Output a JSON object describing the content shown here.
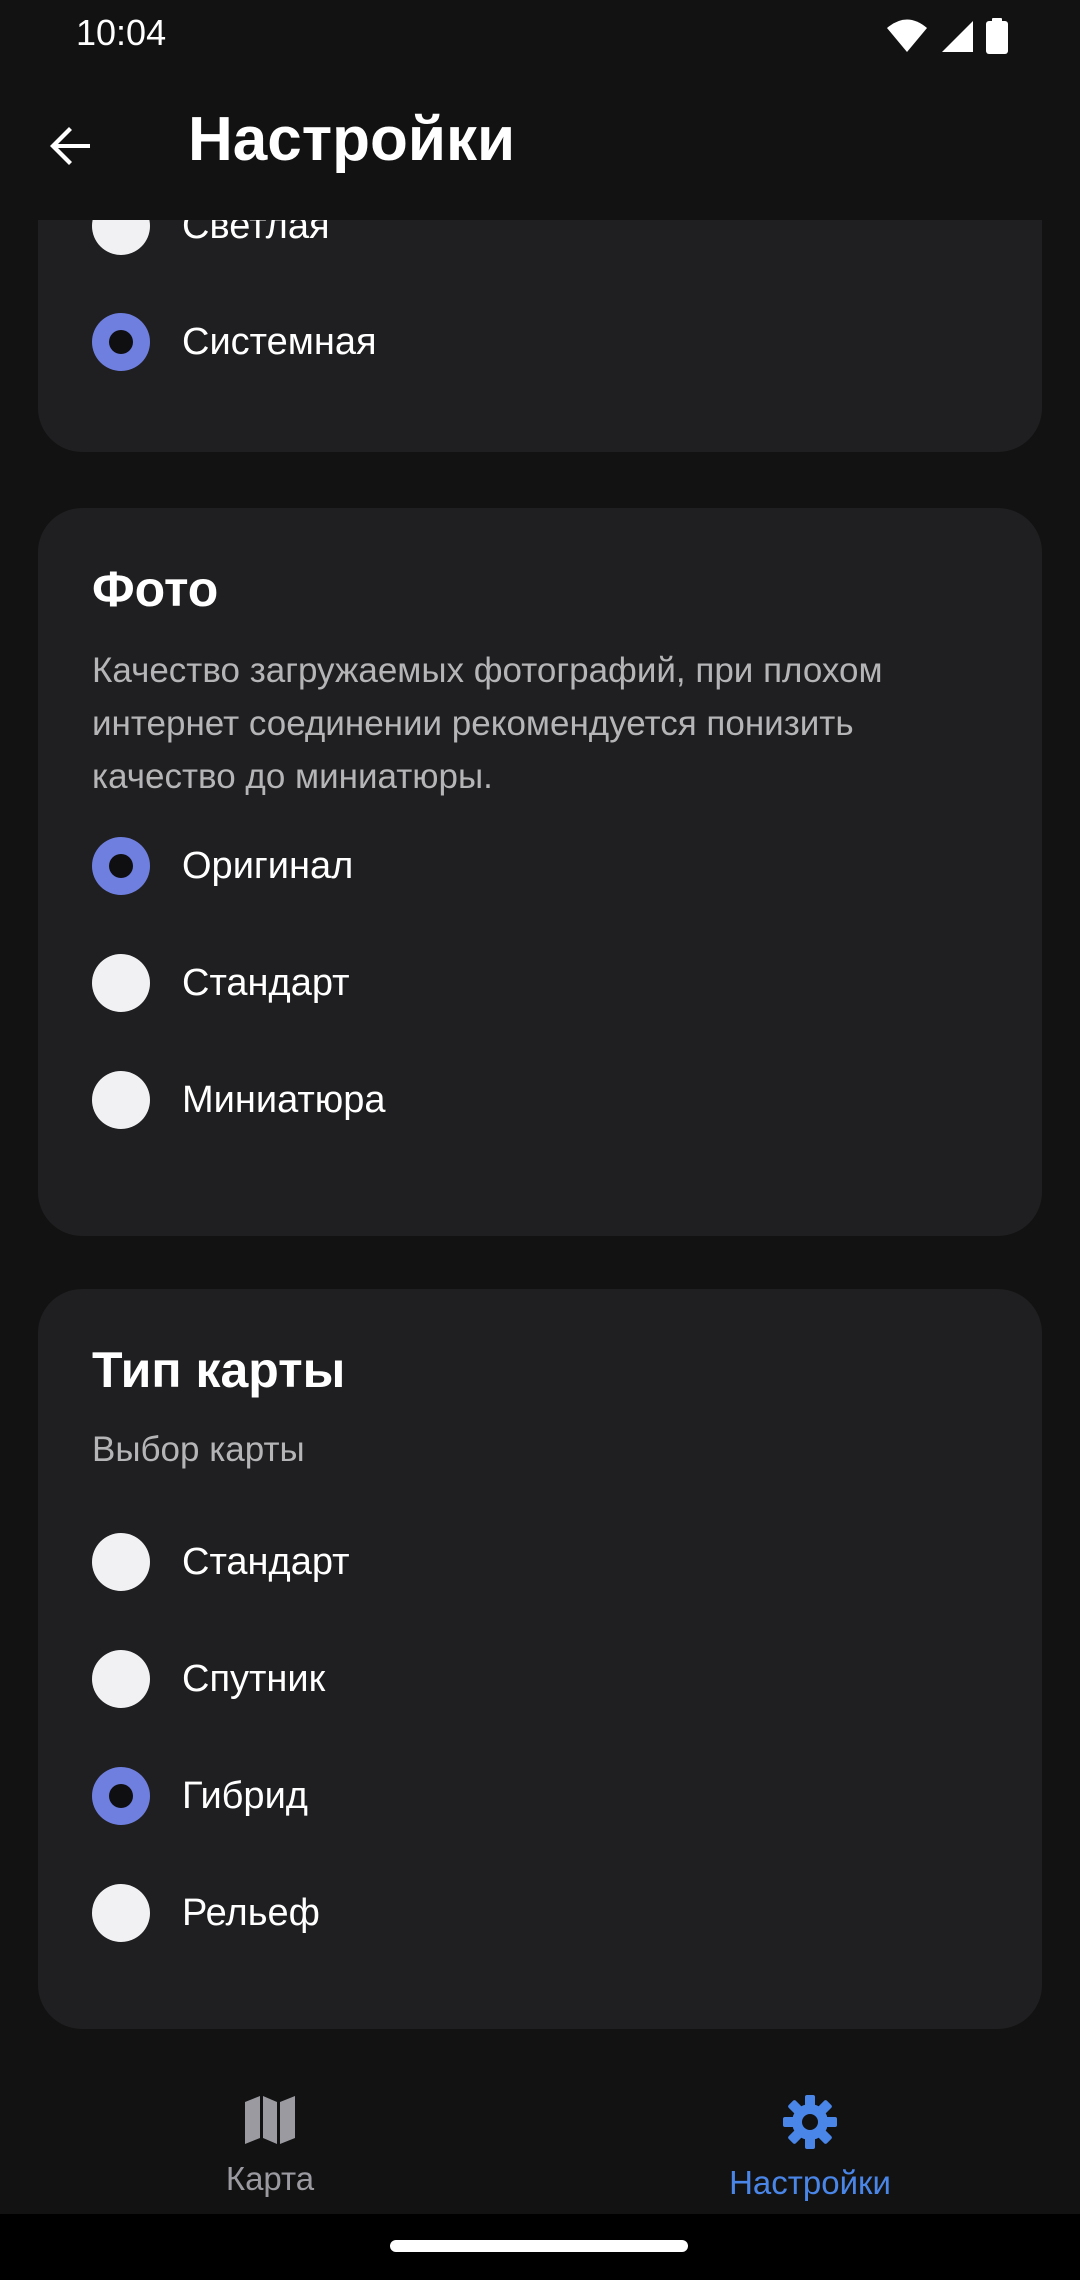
{
  "status_bar": {
    "time": "10:04"
  },
  "app_bar": {
    "title": "Настройки"
  },
  "theme_card": {
    "options": [
      {
        "label": "Светлая",
        "selected": false
      },
      {
        "label": "Системная",
        "selected": true
      }
    ]
  },
  "photo_card": {
    "title": "Фото",
    "description": "Качество загружаемых фотографий, при плохом интернет соединении рекомендуется понизить качество до миниатюры.",
    "options": [
      {
        "label": "Оригинал",
        "selected": true
      },
      {
        "label": "Стандарт",
        "selected": false
      },
      {
        "label": "Миниатюра",
        "selected": false
      }
    ]
  },
  "map_card": {
    "title": "Тип карты",
    "description": "Выбор карты",
    "options": [
      {
        "label": "Стандарт",
        "selected": false
      },
      {
        "label": "Спутник",
        "selected": false
      },
      {
        "label": "Гибрид",
        "selected": true
      },
      {
        "label": "Рельеф",
        "selected": false
      }
    ]
  },
  "bottom_nav": {
    "items": [
      {
        "label": "Карта",
        "icon": "map-icon",
        "active": false
      },
      {
        "label": "Настройки",
        "icon": "gear-icon",
        "active": true
      }
    ]
  },
  "colors": {
    "accent": "#4a86e8",
    "radio_selected": "#6f7fe0",
    "card_bg": "#1f1f21"
  }
}
